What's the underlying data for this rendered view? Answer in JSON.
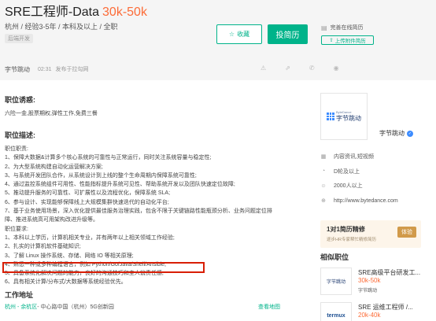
{
  "job": {
    "title": "SRE工程师-Data",
    "salary": "30k-50k",
    "meta": "杭州 / 经验3-5年 / 本科及以上 / 全职",
    "tag": "后端开发"
  },
  "actions": {
    "favorite": "收藏",
    "apply": "投简历",
    "resume_status": "完善在线简历",
    "upload": "上传附件简历"
  },
  "publish": {
    "company": "字节跳动",
    "time": "02:31",
    "source": "发布于拉勾网"
  },
  "perks": {
    "title": "职位诱惑:",
    "text": "六险一金,股票期权,弹性工作,免费三餐"
  },
  "description": {
    "title": "职位描述:",
    "lines": [
      "职位职责:",
      "1、保障大数据&计算多个核心系统的可靠性与正常运行，同时关注系统容量与稳定性;",
      "2、为大型系统构建自动化运营解决方案;",
      "3、与系统开发团队合作，从系统设计到上线的整个生命周期内保障系统可靠性;",
      "4、通过监控系统组件可用性、性能指标提升系统可见性、帮助系统开发以及团队快速定位故障;",
      "5、推动提升服务的可靠性、可扩展性以及流程优化，保障系统 SLA;",
      "6、参与设计、实现能够保障线上大规模集群快速迭代的自动化平台;",
      "7、基于业务使用场景，深入优化提供最佳服务治理实践，包含不限于关键链路性能瓶颈分析、业务问题定位排",
      "障、推进系统高可用架构改进升级等。",
      "职位要求:",
      "1、本科以上学历，计算机相关专业，并有两年以上相关领域工作经验;",
      "2、扎实的计算机软件基础知识;",
      "3、了解 Linux 操作系统、存储、网络 IO 等相关原理;",
      "4、熟悉一种或多种编程语言，例如 Python/Go/Java/Shell/Ansible;",
      "5、具备系统化解决问题的能力，良好的沟通技巧和主人翁责任感;",
      "6、具有相关计算/分布式/大数据等系统经验优先。"
    ]
  },
  "address": {
    "title": "工作地址",
    "city": "杭州 - 余杭区",
    "detail": " - 中心路中国（杭州）5G创新园",
    "map": "查看地图"
  },
  "company_card": {
    "logo_text": "字节跳动",
    "logo_small": "ByteDance",
    "name": "字节跳动",
    "info": [
      {
        "icon": "industry-icon",
        "glyph": "▦",
        "text": "内容资讯,短视频"
      },
      {
        "icon": "funding-icon",
        "glyph": "◔",
        "text": "D轮及以上"
      },
      {
        "icon": "people-icon",
        "glyph": "☺",
        "text": "2000人以上"
      },
      {
        "icon": "website-icon",
        "glyph": "⊕",
        "text": "http://www.bytedance.com"
      }
    ]
  },
  "promo": {
    "title": "1对1简历精修",
    "subtitle": "逐步HR专家帮忙精修简历",
    "button": "体验"
  },
  "similar": {
    "title": "相似职位",
    "items": [
      {
        "name": "SRE高级平台研发工...",
        "salary": "30k-50k",
        "company": "字节跳动",
        "logo": "字节跳动"
      },
      {
        "name": "SRE 运维工程师 /...",
        "salary": "20k-40k",
        "company": "",
        "logo": "termux"
      }
    ]
  },
  "colors": {
    "accent": "#00b38a",
    "salary": "#fc6c38",
    "highlight": "#d81e06"
  }
}
